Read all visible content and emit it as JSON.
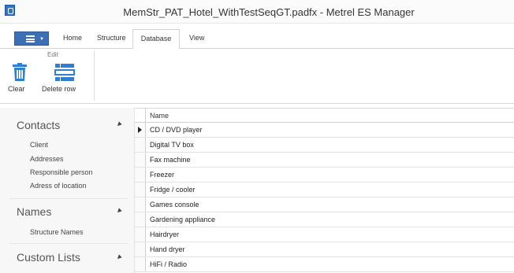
{
  "window": {
    "title": "MemStr_PAT_Hotel_WithTestSeqGT.padfx - Metrel ES Manager",
    "app_icon": "app-icon"
  },
  "ribbon": {
    "file_menu_icon": "menu-icon",
    "tabs": [
      "Home",
      "Structure",
      "Database",
      "View"
    ],
    "active_tab": "Database",
    "group_label": "Edit",
    "buttons": [
      {
        "label": "Clear",
        "icon": "trash-icon"
      },
      {
        "label": "Delete row",
        "icon": "delete-row-icon"
      }
    ]
  },
  "sidebar": {
    "sections": [
      {
        "title": "Contacts",
        "items": [
          "Client",
          "Addresses",
          "Responsible person",
          "Adress of location"
        ]
      },
      {
        "title": "Names",
        "items": [
          "Structure Names"
        ]
      },
      {
        "title": "Custom Lists",
        "items": []
      }
    ]
  },
  "grid": {
    "column": "Name",
    "rows": [
      "CD / DVD player",
      "Digital TV box",
      "Fax machine",
      "Freezer",
      "Fridge / cooler",
      "Games console",
      "Gardening appliance",
      "Hairdryer",
      "Hand dryer",
      "HiFi / Radio"
    ],
    "current_row": 0
  },
  "colors": {
    "accent": "#2f74c9",
    "file_button": "#3d6fb4",
    "sidebar_bg": "#f7f7f7"
  }
}
